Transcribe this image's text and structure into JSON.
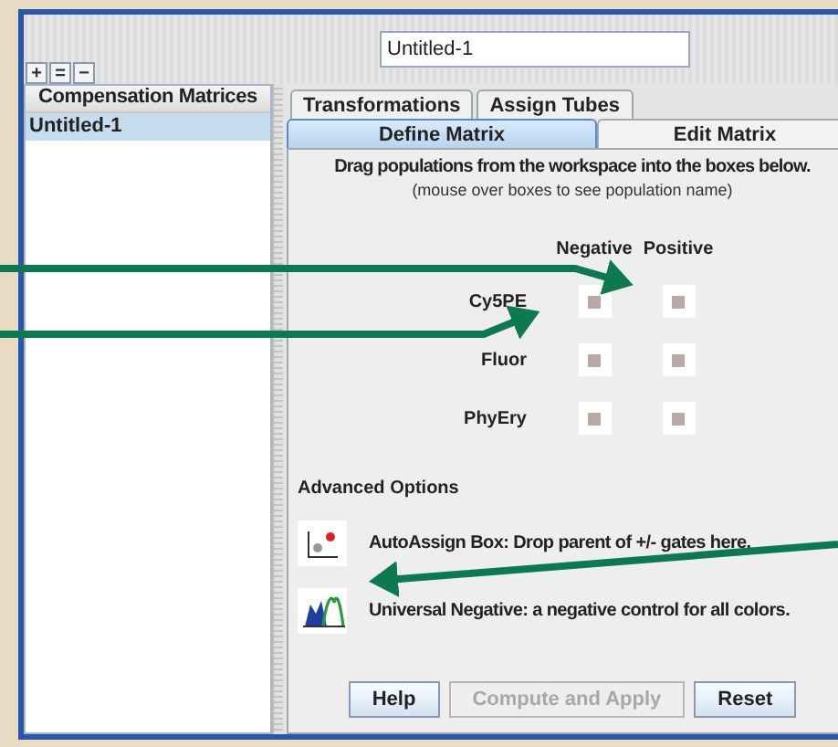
{
  "name_field": {
    "value": "Untitled-1"
  },
  "toolbar_buttons": [
    "+",
    "=",
    "−"
  ],
  "matrices_panel": {
    "header": "Compensation Matrices",
    "items": [
      {
        "label": "Untitled-1",
        "selected": true
      }
    ]
  },
  "tabs": [
    {
      "label": "Transformations",
      "selected": false
    },
    {
      "label": "Assign Tubes",
      "selected": false
    }
  ],
  "subtabs": [
    {
      "label": "Define Matrix",
      "selected": true
    },
    {
      "label": "Edit Matrix",
      "selected": false
    }
  ],
  "instructions": "Drag populations from the workspace into the boxes below.",
  "hint": "(mouse over boxes to see population name)",
  "columns": [
    "Negative",
    "Positive"
  ],
  "rows": [
    "Cy5PE",
    "Fluor",
    "PhyEry"
  ],
  "advanced": {
    "title": "Advanced Options",
    "options": [
      {
        "kind": "scatter",
        "label": "AutoAssign Box: Drop parent of +/- gates here."
      },
      {
        "kind": "histogram",
        "label": "Universal Negative: a negative control for all colors."
      }
    ]
  },
  "buttons": [
    {
      "label": "Help",
      "disabled": false
    },
    {
      "label": "Compute and Apply",
      "disabled": true
    },
    {
      "label": "Reset",
      "disabled": false
    }
  ]
}
